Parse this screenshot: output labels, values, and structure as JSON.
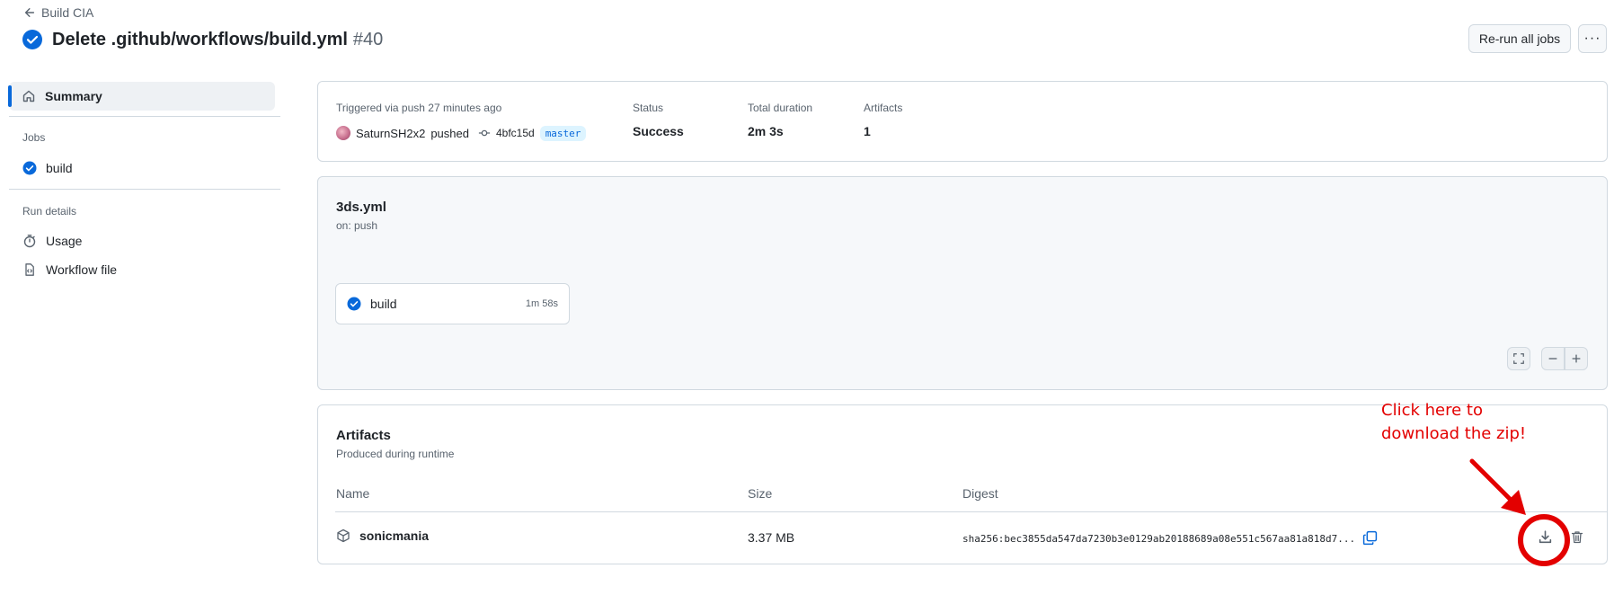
{
  "header": {
    "back_label": "Build CIA",
    "title": "Delete .github/workflows/build.yml",
    "run_number": "#40",
    "rerun_label": "Re-run all jobs",
    "more_label": "···"
  },
  "sidebar": {
    "summary_label": "Summary",
    "jobs_heading": "Jobs",
    "jobs": [
      {
        "label": "build"
      }
    ],
    "run_details_heading": "Run details",
    "details": [
      {
        "label": "Usage"
      },
      {
        "label": "Workflow file"
      }
    ]
  },
  "summary": {
    "trigger_text": "Triggered via push 27 minutes ago",
    "user": "SaturnSH2x2",
    "action": "pushed",
    "commit_sha": "4bfc15d",
    "branch": "master",
    "status_label": "Status",
    "status_value": "Success",
    "duration_label": "Total duration",
    "duration_value": "2m 3s",
    "artifacts_label": "Artifacts",
    "artifacts_value": "1"
  },
  "workflow": {
    "file": "3ds.yml",
    "trigger": "on: push",
    "job_name": "build",
    "job_duration": "1m 58s"
  },
  "artifacts": {
    "title": "Artifacts",
    "subtitle": "Produced during runtime",
    "col_name": "Name",
    "col_size": "Size",
    "col_digest": "Digest",
    "rows": [
      {
        "name": "sonicmania",
        "size": "3.37 MB",
        "digest": "sha256:bec3855da547da7230b3e0129ab20188689a08e551c567aa81a818d7..."
      }
    ]
  },
  "annotation": {
    "line1": "Click here to",
    "line2": "download the zip!",
    "color": "#e30000"
  },
  "colors": {
    "accent": "#0969da",
    "success": "#0969da",
    "border": "#d1d9e0"
  }
}
